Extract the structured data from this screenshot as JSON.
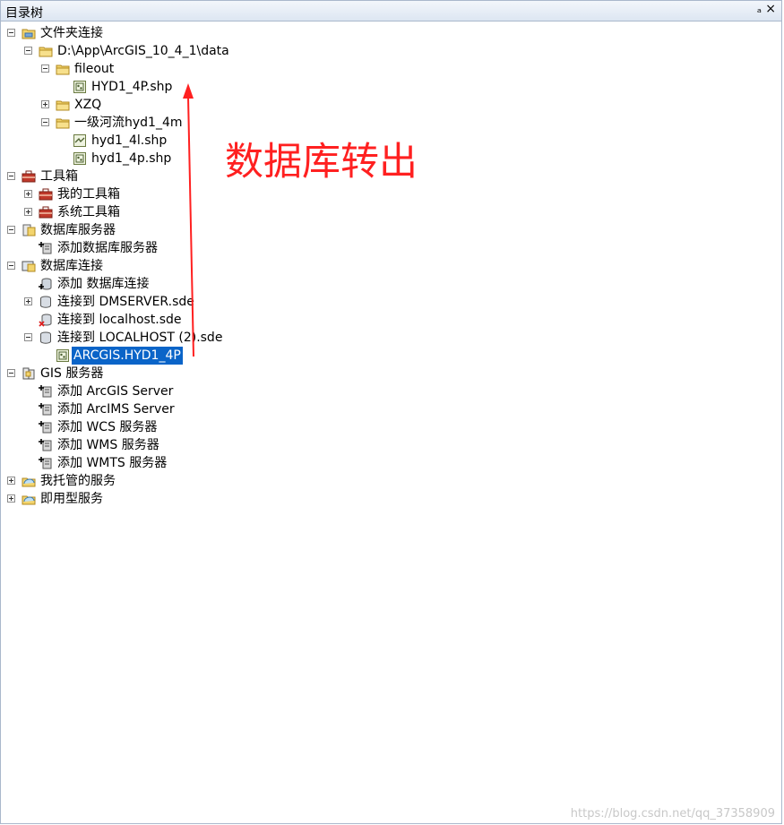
{
  "panel": {
    "title": "目录树",
    "pin_glyph": "ₐ",
    "close_glyph": "×"
  },
  "tree": [
    {
      "id": "folder-connections",
      "label": "文件夹连接",
      "level": 0,
      "expander": "minus",
      "icon": "folder-connection-icon"
    },
    {
      "id": "data-folder",
      "label": "D:\\App\\ArcGIS_10_4_1\\data",
      "level": 1,
      "expander": "minus",
      "icon": "folder-icon"
    },
    {
      "id": "fileout",
      "label": "fileout",
      "level": 2,
      "expander": "minus",
      "icon": "folder-icon"
    },
    {
      "id": "hyd1-4p-shp-upper",
      "label": "HYD1_4P.shp",
      "level": 3,
      "expander": "none",
      "icon": "point-feature-icon"
    },
    {
      "id": "xzq",
      "label": "XZQ",
      "level": 2,
      "expander": "plus",
      "icon": "folder-icon"
    },
    {
      "id": "river-folder",
      "label": "一级河流hyd1_4m",
      "level": 2,
      "expander": "minus",
      "icon": "folder-icon"
    },
    {
      "id": "hyd1-4l-shp",
      "label": "hyd1_4l.shp",
      "level": 3,
      "expander": "none",
      "icon": "line-feature-icon"
    },
    {
      "id": "hyd1-4p-shp",
      "label": "hyd1_4p.shp",
      "level": 3,
      "expander": "none",
      "icon": "point-feature-icon"
    },
    {
      "id": "toolboxes",
      "label": "工具箱",
      "level": 0,
      "expander": "minus",
      "icon": "toolbox-icon"
    },
    {
      "id": "my-toolboxes",
      "label": "我的工具箱",
      "level": 1,
      "expander": "plus",
      "icon": "toolbox-icon"
    },
    {
      "id": "system-toolboxes",
      "label": "系统工具箱",
      "level": 1,
      "expander": "plus",
      "icon": "toolbox-icon"
    },
    {
      "id": "database-servers",
      "label": "数据库服务器",
      "level": 0,
      "expander": "minus",
      "icon": "database-server-icon"
    },
    {
      "id": "add-database-server",
      "label": "添加数据库服务器",
      "level": 1,
      "expander": "none",
      "icon": "add-server-icon"
    },
    {
      "id": "database-connections",
      "label": "数据库连接",
      "level": 0,
      "expander": "minus",
      "icon": "database-connection-icon"
    },
    {
      "id": "add-database-connection",
      "label": "添加 数据库连接",
      "level": 1,
      "expander": "none",
      "icon": "add-connection-icon"
    },
    {
      "id": "dmserver-sde",
      "label": "连接到 DMSERVER.sde",
      "level": 1,
      "expander": "plus",
      "icon": "database-icon"
    },
    {
      "id": "localhost-sde",
      "label": "连接到 localhost.sde",
      "level": 1,
      "expander": "none",
      "icon": "database-error-icon"
    },
    {
      "id": "localhost2-sde",
      "label": "连接到 LOCALHOST (2).sde",
      "level": 1,
      "expander": "minus",
      "icon": "database-icon"
    },
    {
      "id": "arcgis-hyd1-4p",
      "label": "ARCGIS.HYD1_4P",
      "level": 2,
      "expander": "none",
      "icon": "point-feature-icon",
      "selected": true
    },
    {
      "id": "gis-servers",
      "label": "GIS 服务器",
      "level": 0,
      "expander": "minus",
      "icon": "gis-server-icon"
    },
    {
      "id": "add-arcgis-server",
      "label": "添加 ArcGIS Server",
      "level": 1,
      "expander": "none",
      "icon": "add-server-icon"
    },
    {
      "id": "add-arcims-server",
      "label": "添加 ArcIMS Server",
      "level": 1,
      "expander": "none",
      "icon": "add-server-icon"
    },
    {
      "id": "add-wcs-server",
      "label": "添加 WCS 服务器",
      "level": 1,
      "expander": "none",
      "icon": "add-server-icon"
    },
    {
      "id": "add-wms-server",
      "label": "添加 WMS 服务器",
      "level": 1,
      "expander": "none",
      "icon": "add-server-icon"
    },
    {
      "id": "add-wmts-server",
      "label": "添加 WMTS 服务器",
      "level": 1,
      "expander": "none",
      "icon": "add-server-icon"
    },
    {
      "id": "hosted-services",
      "label": "我托管的服务",
      "level": 0,
      "expander": "plus",
      "icon": "hosted-services-icon"
    },
    {
      "id": "ready-to-use-services",
      "label": "即用型服务",
      "level": 0,
      "expander": "plus",
      "icon": "hosted-services-icon"
    }
  ],
  "annotation": {
    "text": "数据库转出",
    "color": "#ff2020"
  },
  "watermark": "https://blog.csdn.net/qq_37358909"
}
